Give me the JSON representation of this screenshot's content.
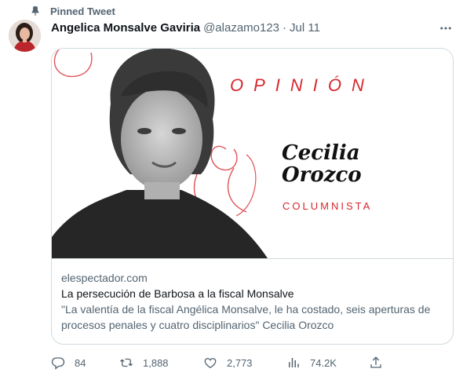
{
  "pinned_label": "Pinned Tweet",
  "author": {
    "name": "Angelica Monsalve Gaviria",
    "handle": "@alazamo123",
    "separator": "·",
    "date": "Jul 11"
  },
  "card": {
    "image": {
      "heading": "OPINIÓN",
      "columnist_name_line1": "Cecilia",
      "columnist_name_line2": "Orozco",
      "columnist_role": "COLUMNISTA"
    },
    "domain": "elespectador.com",
    "title": "La persecución de Barbosa a la fiscal Monsalve",
    "description": "\"La valentía de la fiscal Angélica Monsalve, le ha costado, seis aperturas de procesos penales y cuatro disciplinarios\" Cecilia Orozco"
  },
  "actions": {
    "replies": "84",
    "retweets": "1,888",
    "likes": "2,773",
    "views": "74.2K"
  },
  "colors": {
    "accent_red": "#d8272d",
    "secondary_text": "#536471",
    "primary_text": "#0f1419",
    "border": "#cfd9de"
  },
  "icons": [
    "pin-icon",
    "more-icon",
    "reply-icon",
    "retweet-icon",
    "like-icon",
    "views-icon",
    "share-icon"
  ]
}
